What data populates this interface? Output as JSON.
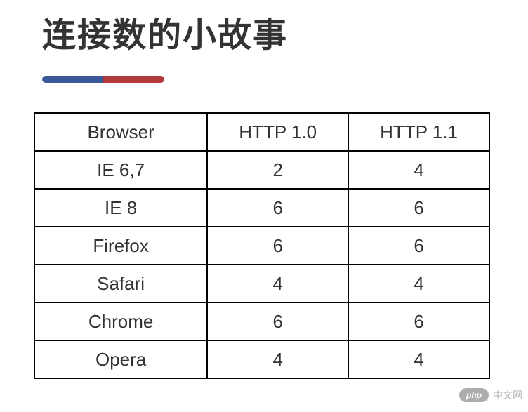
{
  "title": "连接数的小故事",
  "chart_data": {
    "type": "table",
    "columns": [
      "Browser",
      "HTTP 1.0",
      "HTTP 1.1"
    ],
    "rows": [
      {
        "browser": "IE 6,7",
        "http10": "2",
        "http11": "4"
      },
      {
        "browser": "IE 8",
        "http10": "6",
        "http11": "6"
      },
      {
        "browser": "Firefox",
        "http10": "6",
        "http11": "6"
      },
      {
        "browser": "Safari",
        "http10": "4",
        "http11": "4"
      },
      {
        "browser": "Chrome",
        "http10": "6",
        "http11": "6"
      },
      {
        "browser": "Opera",
        "http10": "4",
        "http11": "4"
      }
    ]
  },
  "watermark": {
    "badge": "php",
    "text": "中文网"
  }
}
